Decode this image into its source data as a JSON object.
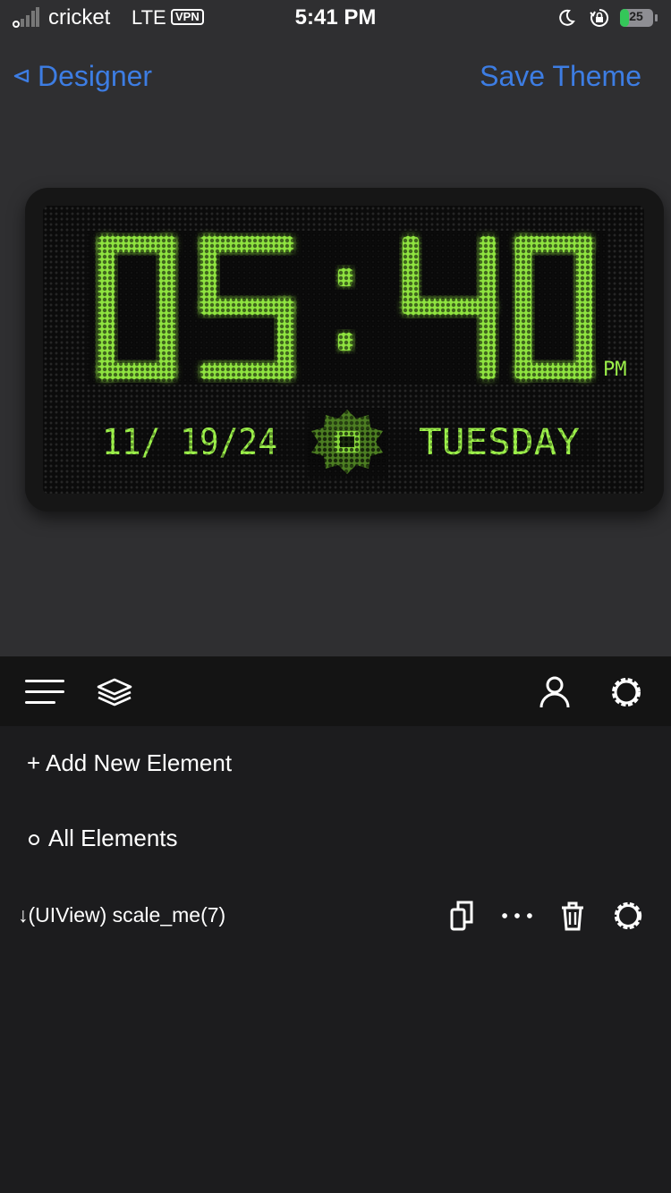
{
  "status_bar": {
    "carrier": "cricket",
    "network": "LTE",
    "vpn_label": "VPN",
    "time": "5:41 PM",
    "battery_percent": "25",
    "icons": [
      "signal-icon",
      "moon-icon",
      "rotation-lock-icon",
      "battery-icon"
    ]
  },
  "nav": {
    "back_label": "Designer",
    "save_label": "Save Theme",
    "accent_color": "#3d7de3"
  },
  "clock": {
    "hours": "05",
    "separator": ":",
    "minutes": "40",
    "ampm": "PM",
    "date": "11/ 19/24",
    "day": "TUESDAY",
    "led_color": "#8fe33f"
  },
  "toolbar": {
    "icons": [
      "menu-icon",
      "layers-icon",
      "user-icon",
      "settings-icon"
    ]
  },
  "list": {
    "add_label": "+ Add New Element",
    "all_label": "All Elements",
    "element_label": "↓(UIView) scale_me(7)",
    "element_actions": [
      "copy-icon",
      "more-icon",
      "trash-icon",
      "settings-icon"
    ]
  }
}
